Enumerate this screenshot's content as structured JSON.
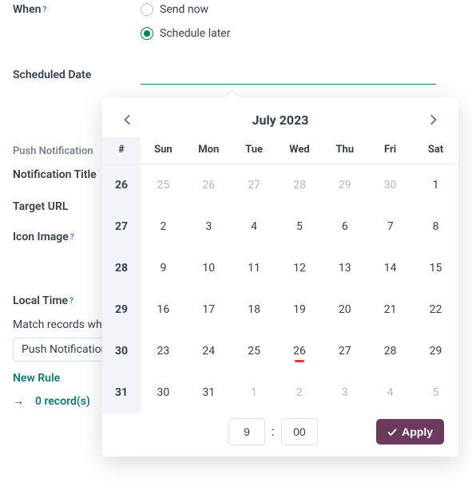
{
  "when": {
    "label": "When",
    "options": {
      "send_now": "Send now",
      "schedule_later": "Schedule later"
    },
    "selected": "schedule_later"
  },
  "scheduled_date": {
    "label": "Scheduled Date",
    "value": ""
  },
  "push_section_heading": "Push Notification",
  "form_labels": {
    "notification_title": "Notification Title",
    "target_url": "Target URL",
    "icon_image": "Icon Image",
    "local_time": "Local Time",
    "match_records": "Match records where"
  },
  "rule_select_value": "Push Notification",
  "new_rule_label": "New Rule",
  "records_link": "0 record(s)",
  "datepicker": {
    "month_label": "July 2023",
    "week_col_header": "#",
    "weekday_headers": [
      "Sun",
      "Mon",
      "Tue",
      "Wed",
      "Thu",
      "Fri",
      "Sat"
    ],
    "weeks": [
      {
        "wk": "26",
        "days": [
          {
            "n": "25",
            "other": true
          },
          {
            "n": "26",
            "other": true
          },
          {
            "n": "27",
            "other": true
          },
          {
            "n": "28",
            "other": true
          },
          {
            "n": "29",
            "other": true
          },
          {
            "n": "30",
            "other": true
          },
          {
            "n": "1"
          }
        ]
      },
      {
        "wk": "27",
        "days": [
          {
            "n": "2"
          },
          {
            "n": "3"
          },
          {
            "n": "4"
          },
          {
            "n": "5"
          },
          {
            "n": "6"
          },
          {
            "n": "7"
          },
          {
            "n": "8"
          }
        ]
      },
      {
        "wk": "28",
        "days": [
          {
            "n": "9"
          },
          {
            "n": "10"
          },
          {
            "n": "11"
          },
          {
            "n": "12"
          },
          {
            "n": "13"
          },
          {
            "n": "14"
          },
          {
            "n": "15"
          }
        ]
      },
      {
        "wk": "29",
        "days": [
          {
            "n": "16"
          },
          {
            "n": "17"
          },
          {
            "n": "18"
          },
          {
            "n": "19"
          },
          {
            "n": "20"
          },
          {
            "n": "21"
          },
          {
            "n": "22"
          }
        ]
      },
      {
        "wk": "30",
        "days": [
          {
            "n": "23"
          },
          {
            "n": "24"
          },
          {
            "n": "25"
          },
          {
            "n": "26",
            "today": true
          },
          {
            "n": "27"
          },
          {
            "n": "28"
          },
          {
            "n": "29"
          }
        ]
      },
      {
        "wk": "31",
        "days": [
          {
            "n": "30"
          },
          {
            "n": "31"
          },
          {
            "n": "1",
            "other": true
          },
          {
            "n": "2",
            "other": true
          },
          {
            "n": "3",
            "other": true
          },
          {
            "n": "4",
            "other": true
          },
          {
            "n": "5",
            "other": true
          }
        ]
      }
    ],
    "time": {
      "hour": "9",
      "minute": "00",
      "separator": ":"
    },
    "apply_label": "Apply"
  }
}
